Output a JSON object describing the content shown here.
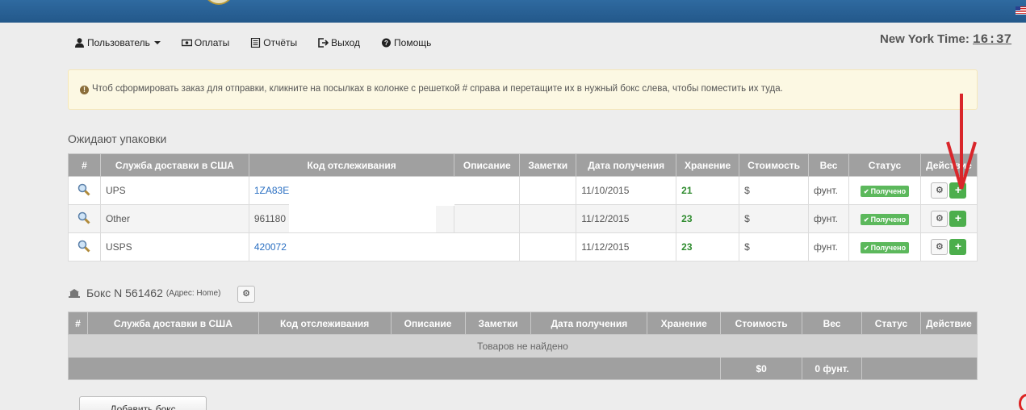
{
  "nav": {
    "user": "Пользователь",
    "payments": "Оплаты",
    "reports": "Отчёты",
    "logout": "Выход",
    "help": "Помощь"
  },
  "time": {
    "label": "New York Time:",
    "value": "16:37"
  },
  "alert": {
    "text": "Чтоб сформировать заказ для отправки, кликните на посылках в колонке с решеткой # справа и перетащите их в нужный бокс слева, чтобы поместить их туда."
  },
  "awaiting": {
    "title": "Ожидают упаковки",
    "headers": [
      "#",
      "Служба доставки в США",
      "Код отслеживания",
      "Описание",
      "Заметки",
      "Дата получения",
      "Хранение",
      "Стоимость",
      "Вес",
      "Статус",
      "Действие"
    ],
    "rows": [
      {
        "carrier": "UPS",
        "tracking": "1ZA83E",
        "description": "",
        "notes": "",
        "date": "11/10/2015",
        "storage": "21",
        "cost": "$",
        "weight": "фунт.",
        "status": "Получено"
      },
      {
        "carrier": "Other",
        "tracking": "961180",
        "description": "",
        "notes": "",
        "date": "11/12/2015",
        "storage": "23",
        "cost": "$",
        "weight": "фунт.",
        "status": "Получено"
      },
      {
        "carrier": "USPS",
        "tracking": "420072",
        "description": "",
        "notes": "",
        "date": "11/12/2015",
        "storage": "23",
        "cost": "$",
        "weight": "фунт.",
        "status": "Получено"
      }
    ]
  },
  "box": {
    "title": "Бокс N 561462",
    "address": "(Адрес: Home)",
    "headers": [
      "#",
      "Служба доставки в США",
      "Код отслеживания",
      "Описание",
      "Заметки",
      "Дата получения",
      "Хранение",
      "Стоимость",
      "Вес",
      "Статус",
      "Действие"
    ],
    "empty_text": "Товаров не найдено",
    "total_cost": "$0",
    "total_weight": "0 фунт."
  },
  "add_box_label": "Добавить бокс",
  "colors": {
    "header_bar": "#2f6aa0",
    "table_header": "#a0a0a0",
    "status_badge": "#5cb85c",
    "annotation_arrow": "#d9262b"
  }
}
